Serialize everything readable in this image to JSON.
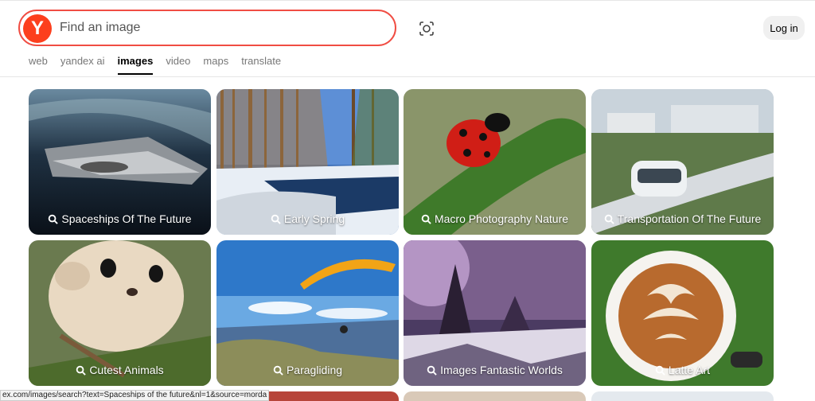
{
  "search": {
    "placeholder": "Find an image",
    "logo_letter": "Y"
  },
  "header": {
    "login_label": "Log in"
  },
  "tabs": [
    {
      "label": "web"
    },
    {
      "label": "yandex ai"
    },
    {
      "label": "images",
      "active": true
    },
    {
      "label": "video"
    },
    {
      "label": "maps"
    },
    {
      "label": "translate"
    }
  ],
  "cards": [
    {
      "label": "Spaceships Of The Future"
    },
    {
      "label": "Early Spring"
    },
    {
      "label": "Macro Photography Nature"
    },
    {
      "label": "Transportation Of The Future"
    },
    {
      "label": "Cutest Animals"
    },
    {
      "label": "Paragliding"
    },
    {
      "label": "Images Fantastic Worlds"
    },
    {
      "label": "Latte Art"
    }
  ],
  "status_bar": {
    "url": "ex.com/images/search?text=Spaceships of the future&nl=1&source=morda"
  },
  "colors": {
    "accent": "#f04d43",
    "brand": "#fc3f1d"
  }
}
